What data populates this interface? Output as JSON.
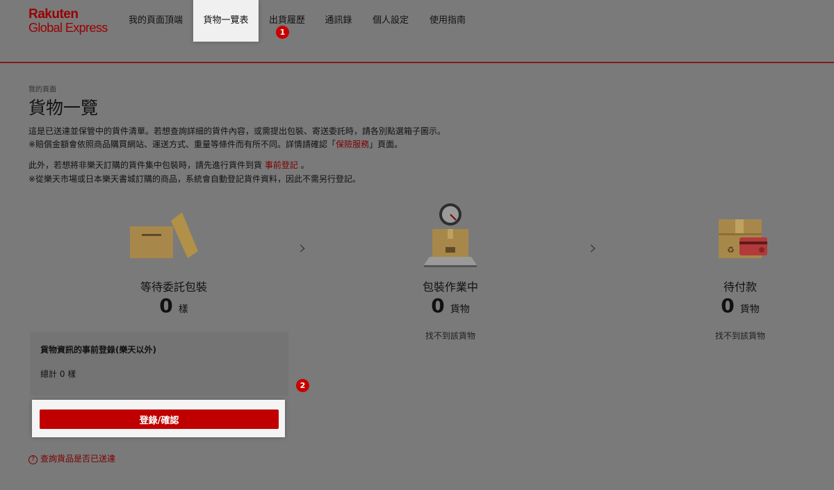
{
  "header": {
    "logo_line1": "Rakuten",
    "logo_line2": "Global Express",
    "nav": [
      {
        "label": "我的頁面頂端"
      },
      {
        "label": "貨物一覽表"
      },
      {
        "label": "出貨履歷"
      },
      {
        "label": "通訊錄"
      },
      {
        "label": "個人設定"
      },
      {
        "label": "使用指南"
      }
    ],
    "active_tab": "貨物一覽表"
  },
  "badges": [
    "1",
    "2"
  ],
  "breadcrumb": "我的頁面",
  "title": "貨物一覽",
  "description": {
    "line1": "這是已送達並保管中的貨件清單。若想查詢詳細的貨件內容，或需提出包裝、寄送委託時，請各別點選箱子圖示。",
    "line2_pre": "※賠償金額會依照商品購買網站、運送方式、重量等條件而有所不同。詳情請確認「",
    "line2_link": "保險服務",
    "line2_post": "」頁面。",
    "line3_pre": "此外，若想將非樂天訂購的貨件集中包裝時，請先進行貨件到貨",
    "line3_link": "事前登記",
    "line3_post": "。",
    "line4": "※從樂天市場或日本樂天書城訂購的商品，系統會自動登記貨件資料，因此不需另行登記。"
  },
  "steps": [
    {
      "label": "等待委託包裝",
      "count": "0",
      "unit": "樣",
      "icon": "open-box-icon"
    },
    {
      "label": "包裝作業中",
      "count": "0",
      "unit": "貨物",
      "note": "找不到該貨物",
      "icon": "scale-box-icon"
    },
    {
      "label": "待付款",
      "count": "0",
      "unit": "貨物",
      "note": "找不到該貨物",
      "icon": "box-card-icon"
    }
  ],
  "step_arrow": "›",
  "panel": {
    "title": "貨物資訊的事前登錄(樂天以外)",
    "total_label": "總計",
    "total_value": "0",
    "total_unit": "樣",
    "button_label": "登錄/確認"
  },
  "help_icon": "?",
  "help_link": "查詢貨品是否已送達",
  "colors": {
    "brand": "#bf0000",
    "overlay": "#7a7a7a",
    "link": "#7a0000"
  }
}
